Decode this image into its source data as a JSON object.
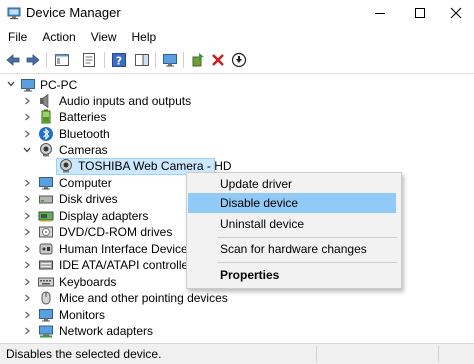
{
  "window": {
    "title": "Device Manager"
  },
  "menu": [
    "File",
    "Action",
    "View",
    "Help"
  ],
  "tree": {
    "root": "PC-PC",
    "categories": [
      {
        "label": "Audio inputs and outputs",
        "icon": "speaker-icon"
      },
      {
        "label": "Batteries",
        "icon": "battery-icon"
      },
      {
        "label": "Bluetooth",
        "icon": "bluetooth-icon"
      },
      {
        "label": "Cameras",
        "icon": "camera-icon",
        "expanded": true
      },
      {
        "label": "Computer",
        "icon": "computer-icon"
      },
      {
        "label": "Disk drives",
        "icon": "disk-drive-icon"
      },
      {
        "label": "Display adapters",
        "icon": "display-adapter-icon"
      },
      {
        "label": "DVD/CD-ROM drives",
        "icon": "dvd-drive-icon"
      },
      {
        "label": "Human Interface Devices",
        "icon": "hid-icon"
      },
      {
        "label": "IDE ATA/ATAPI controllers",
        "icon": "ide-controller-icon"
      },
      {
        "label": "Keyboards",
        "icon": "keyboard-icon"
      },
      {
        "label": "Mice and other pointing devices",
        "icon": "mouse-icon"
      },
      {
        "label": "Monitors",
        "icon": "monitor-icon"
      },
      {
        "label": "Network adapters",
        "icon": "network-adapter-icon"
      }
    ],
    "camera_device": "TOSHIBA Web Camera - HD"
  },
  "context_menu": {
    "items": [
      {
        "label": "Update driver"
      },
      {
        "label": "Disable device",
        "highlighted": true
      },
      {
        "label": "Uninstall device"
      },
      {
        "label": "Scan for hardware changes"
      },
      {
        "label": "Properties",
        "bold": true
      }
    ]
  },
  "status": {
    "text": "Disables the selected device."
  },
  "colors": {
    "selection": "#cce8ff",
    "menu_highlight": "#91c9f7",
    "remove_red": "#d11f1f",
    "enable_green": "#3a9a3a"
  }
}
